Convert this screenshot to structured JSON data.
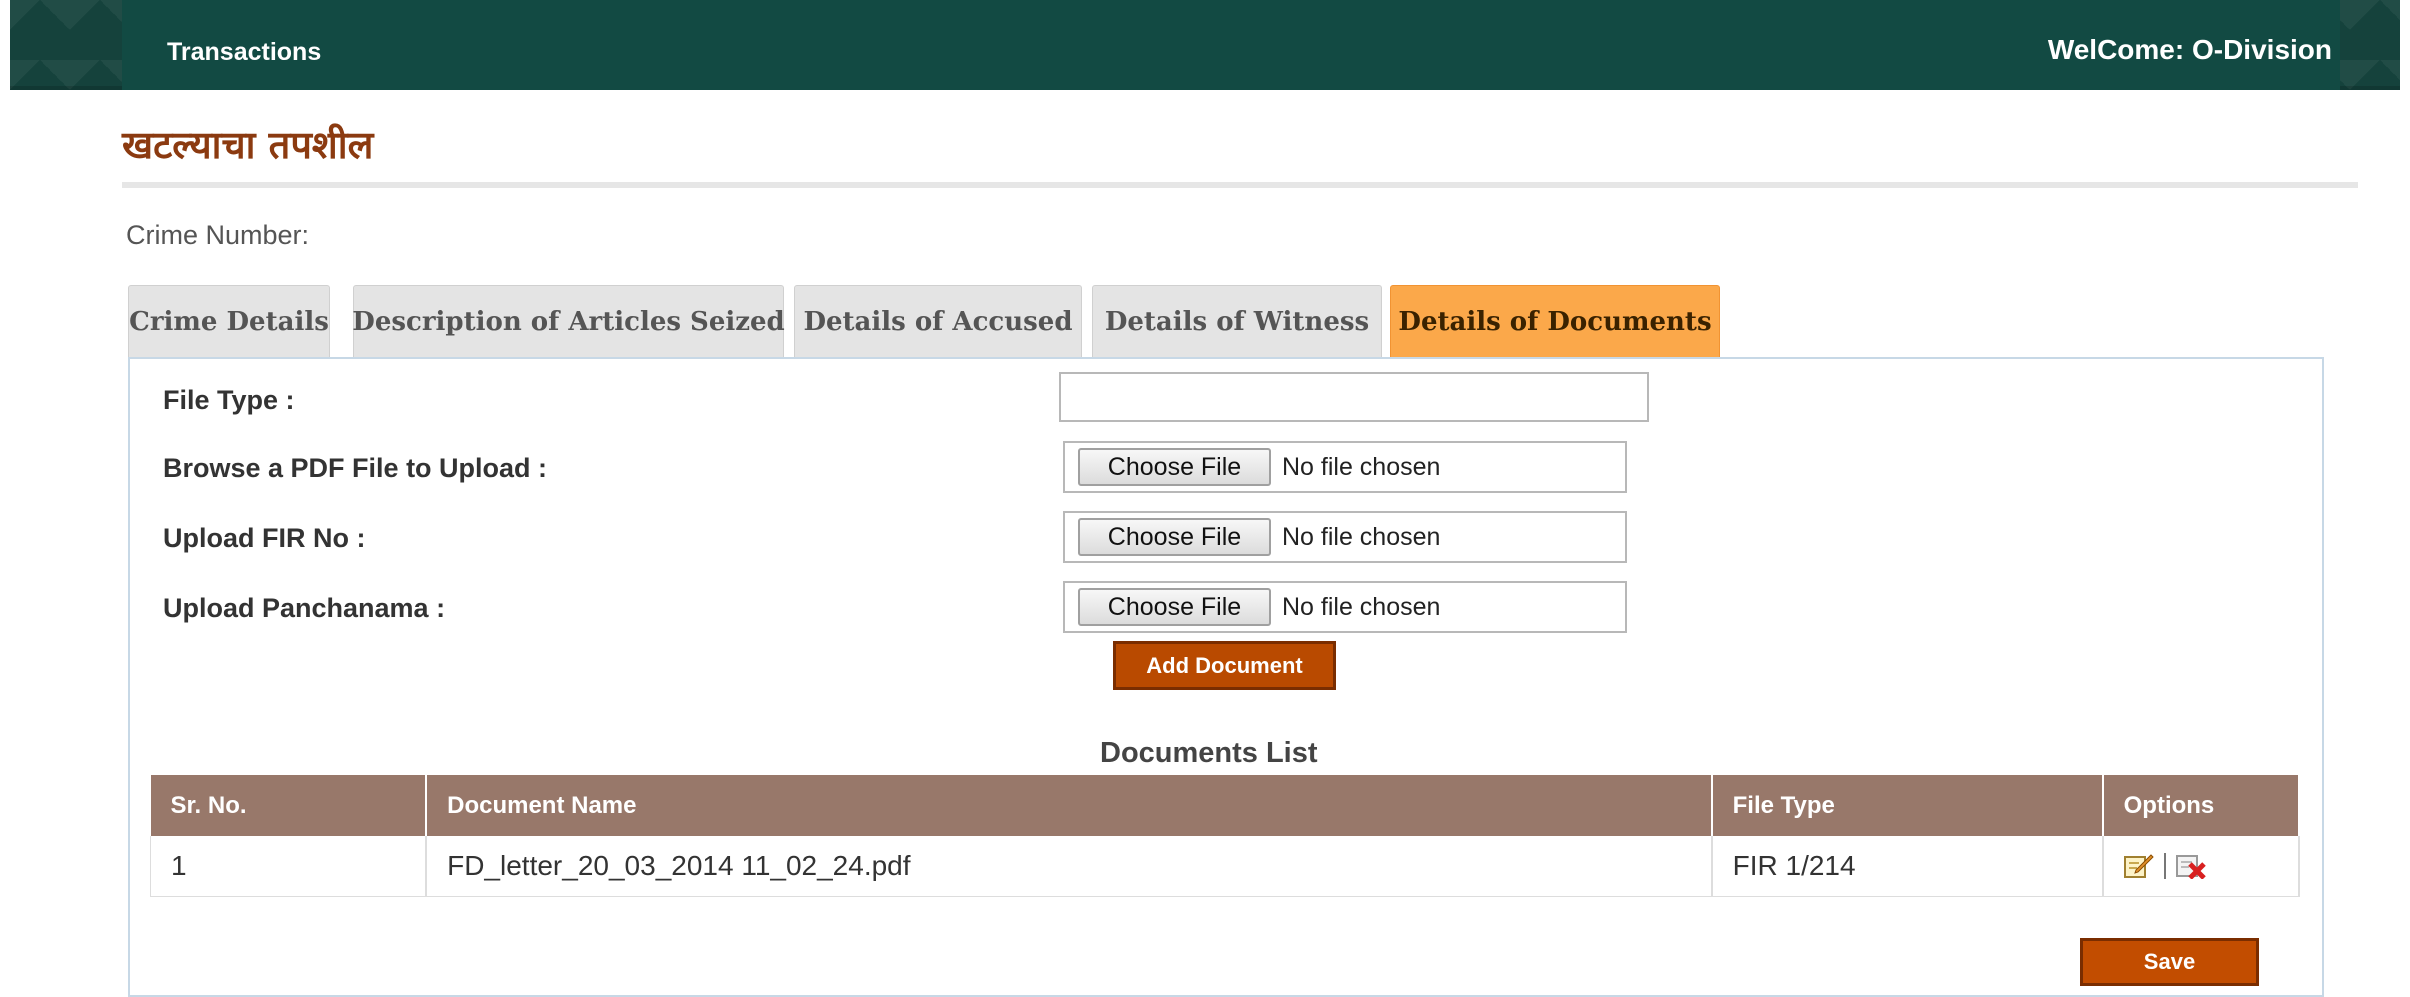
{
  "header": {
    "nav_transactions": "Transactions",
    "welcome": "WelCome: O-Division"
  },
  "page": {
    "title": "खटल्याचा तपशील",
    "crime_number_label": "Crime Number:"
  },
  "tabs": [
    {
      "label": "Crime Details",
      "active": false
    },
    {
      "label": "Description of Articles Seized",
      "active": false
    },
    {
      "label": "Details of Accused",
      "active": false
    },
    {
      "label": "Details of Witness",
      "active": false
    },
    {
      "label": "Details of Documents",
      "active": true
    }
  ],
  "form": {
    "file_type_label": "File Type :",
    "file_type_value": "",
    "pdf_label": "Browse a PDF File to Upload :",
    "fir_label": "Upload FIR No :",
    "panchanama_label": "Upload Panchanama :",
    "choose_file": "Choose File",
    "no_file": "No file chosen",
    "add_document": "Add Document"
  },
  "documents": {
    "title": "Documents List",
    "columns": [
      "Sr. No.",
      "Document Name",
      "File Type",
      "Options"
    ],
    "rows": [
      {
        "sr": "1",
        "name": "FD_letter_20_03_2014 11_02_24.pdf",
        "type": "FIR 1/214"
      }
    ]
  },
  "actions": {
    "save": "Save"
  },
  "icons": {
    "edit": "edit-icon",
    "delete": "delete-icon"
  },
  "colors": {
    "header_bg": "#124a43",
    "title": "#8b3a10",
    "active_tab": "#fba84a",
    "button": "#b94a00",
    "table_header": "#98786a"
  }
}
